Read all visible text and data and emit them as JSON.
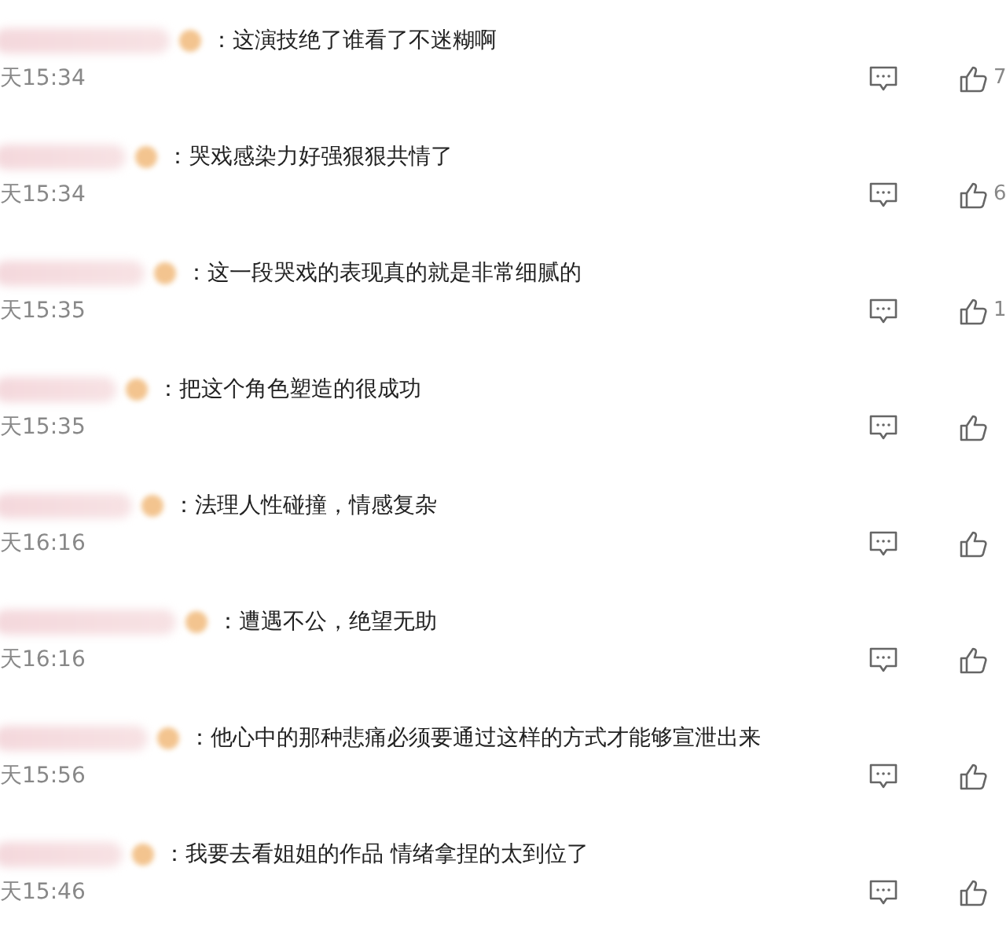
{
  "comments": [
    {
      "text": "：这演技绝了谁看了不迷糊啊",
      "time": "天15:34",
      "likes": "7"
    },
    {
      "text": "：哭戏感染力好强狠狠共情了",
      "time": "天15:34",
      "likes": "6"
    },
    {
      "text": "：这一段哭戏的表现真的就是非常细腻的",
      "time": "天15:35",
      "likes": "1"
    },
    {
      "text": "：把这个角色塑造的很成功",
      "time": "天15:35"
    },
    {
      "text": "：法理人性碰撞，情感复杂",
      "time": "天16:16"
    },
    {
      "text": "：遭遇不公，绝望无助",
      "time": "天16:16"
    },
    {
      "text": "：他心中的那种悲痛必须要通过这样的方式才能够宣泄出来",
      "time": "天15:56"
    },
    {
      "text": "：我要去看姐姐的作品 情绪拿捏的太到位了",
      "time": "天15:46"
    }
  ]
}
